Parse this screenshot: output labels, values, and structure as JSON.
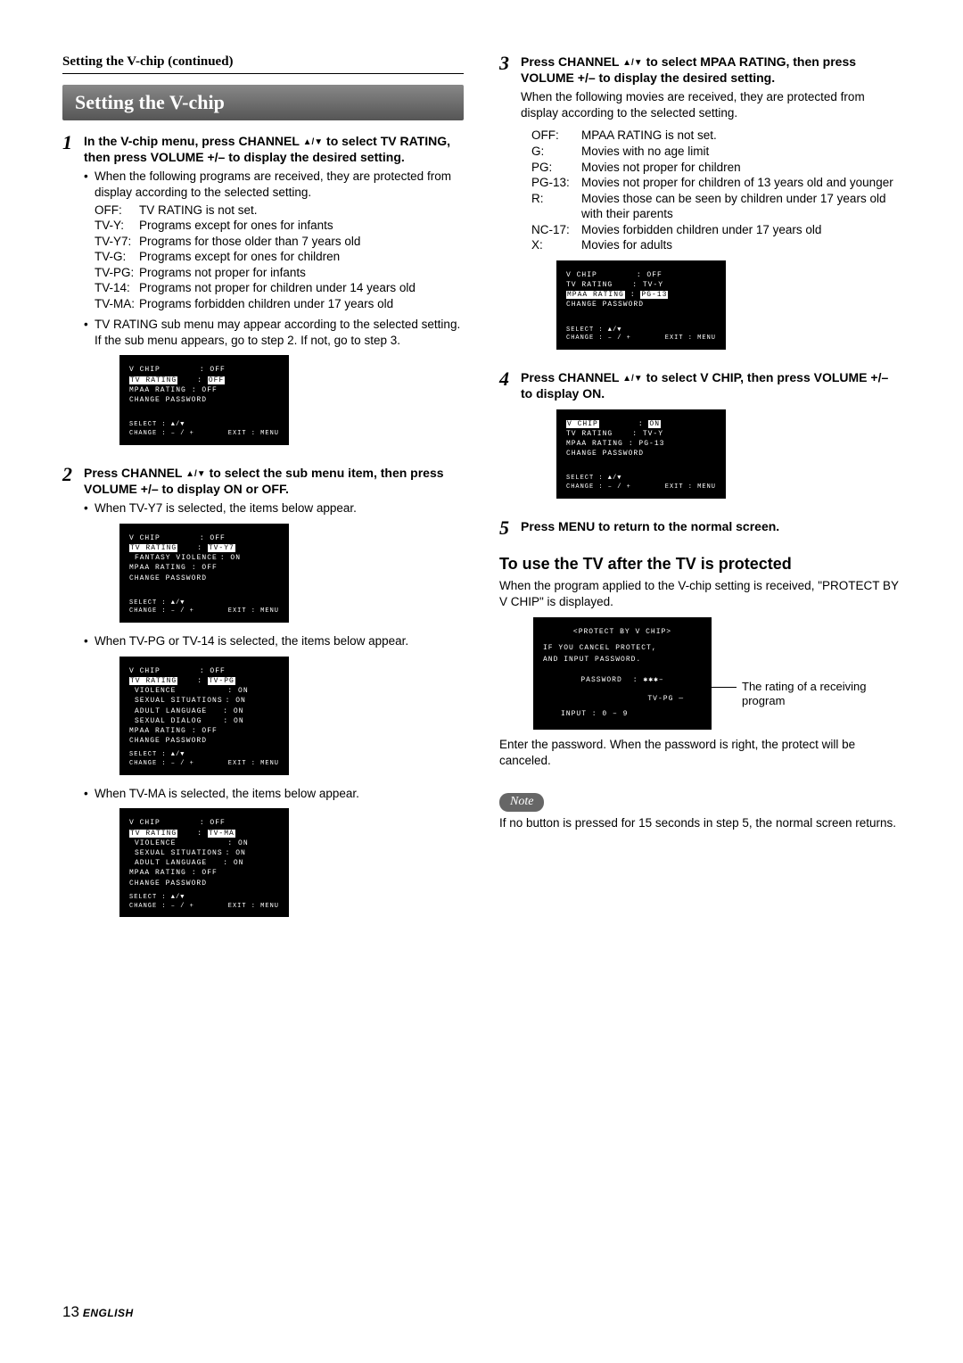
{
  "breadcrumb": "Setting the V-chip (continued)",
  "section_title": "Setting the V-chip",
  "step1": {
    "num": "1",
    "head_a": "In the V-chip menu, press CHANNEL ",
    "head_b": " to select TV RATING, then press VOLUME +/– to display the desired setting.",
    "bullet1": "When the following programs are received, they are protected from display according to the selected setting.",
    "defs": [
      {
        "k": "OFF:",
        "v": "TV RATING is not set."
      },
      {
        "k": "TV-Y:",
        "v": "Programs except for ones for infants"
      },
      {
        "k": "TV-Y7:",
        "v": "Programs for those older than 7 years old"
      },
      {
        "k": "TV-G:",
        "v": "Programs except for ones for children"
      },
      {
        "k": "TV-PG:",
        "v": "Programs not proper for infants"
      },
      {
        "k": "TV-14:",
        "v": "Programs not proper for children under 14 years old"
      },
      {
        "k": "TV-MA:",
        "v": "Programs forbidden children under 17 years old"
      }
    ],
    "bullet2": "TV RATING sub menu may appear according to the selected setting. If the sub menu appears, go to step 2. If not, go to step 3."
  },
  "step2": {
    "num": "2",
    "head_a": "Press CHANNEL ",
    "head_b": " to select the sub menu item, then press VOLUME +/– to display ON or OFF.",
    "bullet1": "When TV-Y7 is selected, the items below appear.",
    "bullet2": "When TV-PG or TV-14 is selected, the items below appear.",
    "bullet3": "When TV-MA is selected, the items below appear."
  },
  "step3": {
    "num": "3",
    "head_a": "Press CHANNEL ",
    "head_b": " to select MPAA RATING, then press VOLUME +/– to display the desired setting.",
    "bullet1": "When the following movies are received, they are protected from display according to the selected setting.",
    "defs": [
      {
        "k": "OFF:",
        "v": "MPAA RATING is not set."
      },
      {
        "k": "G:",
        "v": "Movies with no age limit"
      },
      {
        "k": "PG:",
        "v": "Movies not proper for children"
      },
      {
        "k": "PG-13:",
        "v": "Movies not proper for children of 13 years old and younger"
      },
      {
        "k": "R:",
        "v": "Movies those can be seen by children under 17 years old with their parents"
      },
      {
        "k": "NC-17:",
        "v": "Movies forbidden children under 17 years old"
      },
      {
        "k": "X:",
        "v": "Movies for adults"
      }
    ]
  },
  "step4": {
    "num": "4",
    "head_a": "Press CHANNEL ",
    "head_b": " to select V CHIP, then press VOLUME +/– to display ON."
  },
  "step5": {
    "num": "5",
    "head": "Press MENU to return to the normal screen."
  },
  "use_after": {
    "title": "To use the TV after the TV is protected",
    "p1": "When the program applied to the V-chip setting is received, \"PROTECT BY V CHIP\" is displayed.",
    "p2": "Enter the password.  When the password is right, the protect will be canceled.",
    "callout": "The rating of a receiving program"
  },
  "note": {
    "label": "Note",
    "text": "If no button is pressed for 15 seconds in step 5, the normal screen returns."
  },
  "osd_common": {
    "vchip": "V CHIP",
    "tvrating": "TV RATING",
    "mpaa": "MPAA RATING",
    "changepw": "CHANGE PASSWORD",
    "select": "SELECT : ▲/▼",
    "change": "CHANGE : – / +",
    "exit": "EXIT : MENU"
  },
  "osd1": {
    "vchip": "OFF",
    "tvrat": "OFF",
    "mpaa": "OFF"
  },
  "osd2": {
    "vchip": "OFF",
    "tvrat": "TV-Y7",
    "fantasy": "FANTASY VIOLENCE",
    "fantasy_v": "ON",
    "mpaa": "OFF"
  },
  "osd3": {
    "vchip": "OFF",
    "tvrat": "TV-PG",
    "rows": [
      {
        "k": "VIOLENCE",
        "v": "ON"
      },
      {
        "k": "SEXUAL SITUATIONS",
        "v": "ON"
      },
      {
        "k": "ADULT LANGUAGE",
        "v": "ON"
      },
      {
        "k": "SEXUAL DIALOG",
        "v": "ON"
      }
    ],
    "mpaa": "OFF"
  },
  "osd4": {
    "vchip": "OFF",
    "tvrat": "TV-MA",
    "rows": [
      {
        "k": "VIOLENCE",
        "v": "ON"
      },
      {
        "k": "SEXUAL SITUATIONS",
        "v": "ON"
      },
      {
        "k": "ADULT LANGUAGE",
        "v": "ON"
      }
    ],
    "mpaa": "OFF"
  },
  "osd5": {
    "vchip": "OFF",
    "tvrat": "TV-Y",
    "mpaa": "PG-13"
  },
  "osd6": {
    "vchip": "ON",
    "tvrat": "TV-Y",
    "mpaa": "PG-13"
  },
  "protect": {
    "title": "<PROTECT BY V CHIP>",
    "l1": "IF YOU CANCEL PROTECT,",
    "l2": "AND INPUT PASSWORD.",
    "pw": "PASSWORD",
    "pwv": "✱✱✱–",
    "rating": "TV-PG",
    "input": "INPUT : 0 – 9"
  },
  "footer": {
    "page": "13",
    "lang": "ENGLISH"
  }
}
